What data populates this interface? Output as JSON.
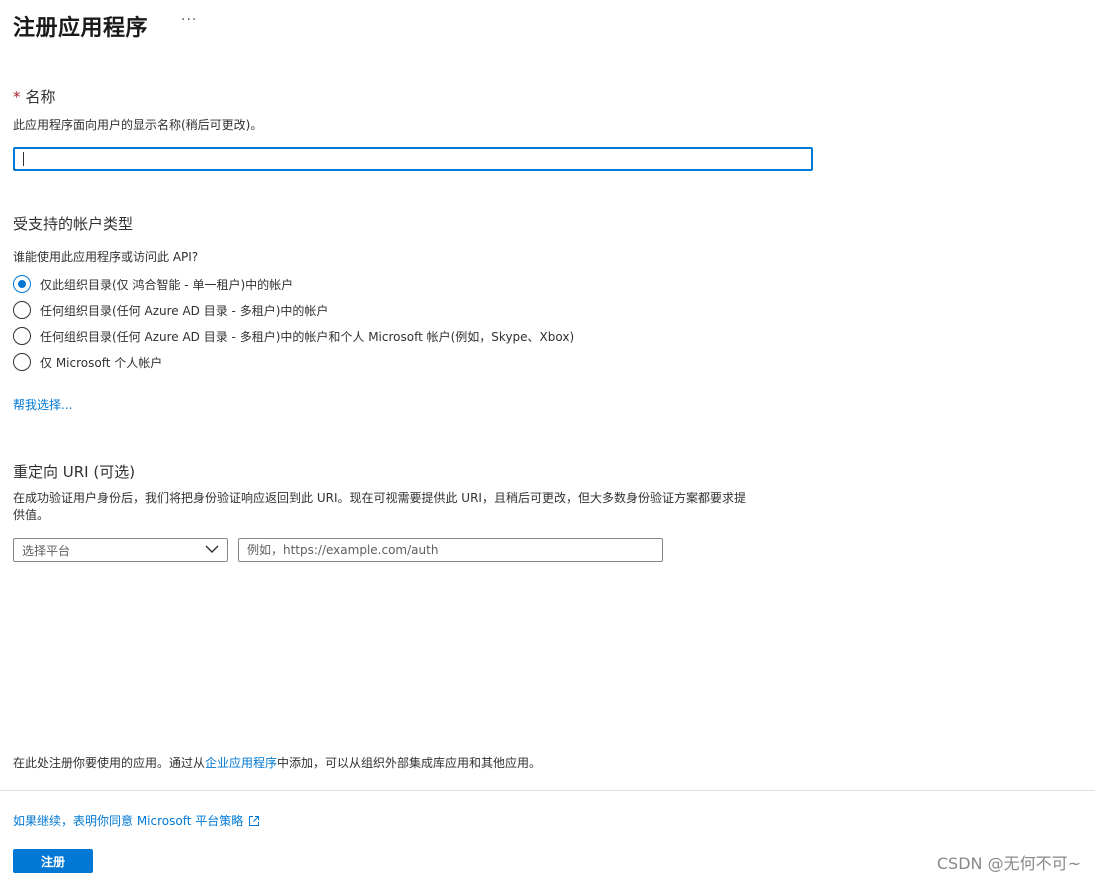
{
  "header": {
    "title": "注册应用程序",
    "more": "···"
  },
  "name_section": {
    "required_mark": "*",
    "title": "名称",
    "description": "此应用程序面向用户的显示名称(稍后可更改)。",
    "input_value": ""
  },
  "account_types": {
    "title": "受支持的帐户类型",
    "question": "谁能使用此应用程序或访问此 API?",
    "options": [
      {
        "label": "仅此组织目录(仅 鸿合智能 - 单一租户)中的帐户",
        "checked": true
      },
      {
        "label": "任何组织目录(任何 Azure AD 目录 - 多租户)中的帐户",
        "checked": false
      },
      {
        "label": "任何组织目录(任何 Azure AD 目录 - 多租户)中的帐户和个人 Microsoft 帐户(例如，Skype、Xbox)",
        "checked": false
      },
      {
        "label": "仅 Microsoft 个人帐户",
        "checked": false
      }
    ],
    "help_link": "帮我选择..."
  },
  "redirect": {
    "title": "重定向 URI (可选)",
    "description_line1": "在成功验证用户身份后，我们将把身份验证响应返回到此 URI。现在可视需要提供此 URI，且稍后可更改，但大多数身份验证方案都要求提",
    "description_line2": "供值。",
    "platform_select": "选择平台",
    "uri_placeholder": "例如，https://example.com/auth"
  },
  "footer": {
    "note_prefix": "在此处注册你要使用的应用。通过从",
    "note_link": "企业应用程序",
    "note_suffix": "中添加，可以从组织外部集成库应用和其他应用。",
    "policy_link": "如果继续，表明你同意 Microsoft 平台策略",
    "register_button": "注册",
    "watermark": "CSDN @无何不可~"
  },
  "colors": {
    "accent": "#0078d4",
    "required": "#a4262c",
    "text": "#323130",
    "divider": "#e1dfdd"
  }
}
